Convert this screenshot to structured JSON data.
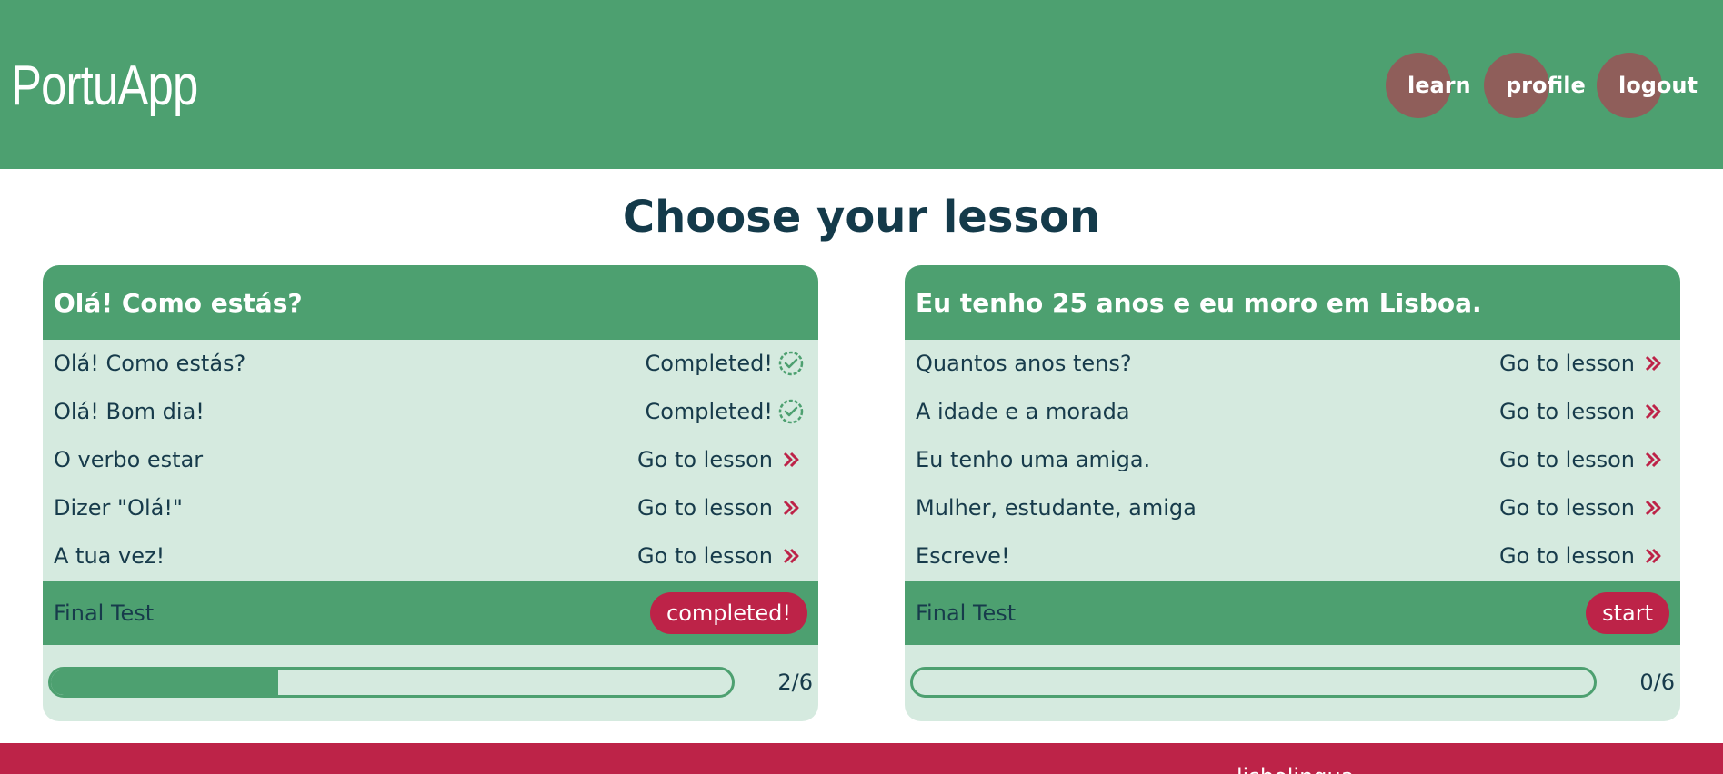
{
  "app": {
    "name": "PortuApp"
  },
  "colors": {
    "brand_green": "#4da070",
    "light_green": "#d5eadf",
    "accent_red": "#bd2348",
    "nav_circle": "#8f5e5a",
    "text_dark": "#173b4b",
    "completed_icon": "#4da070"
  },
  "nav": {
    "items": [
      {
        "label": "learn"
      },
      {
        "label": "profile"
      },
      {
        "label": "logout"
      }
    ]
  },
  "page": {
    "title": "Choose your lesson"
  },
  "units": [
    {
      "title": "Olá! Como estás?",
      "lessons": [
        {
          "name": "Olá! Como estás?",
          "action": "Completed!",
          "status": "completed",
          "icon": "check-badge-icon"
        },
        {
          "name": "Olá! Bom dia!",
          "action": "Completed!",
          "status": "completed",
          "icon": "check-badge-icon"
        },
        {
          "name": "O verbo estar",
          "action": "Go to lesson",
          "status": "open",
          "icon": "double-chevron-right-icon"
        },
        {
          "name": "Dizer \"Olá!\"",
          "action": "Go to lesson",
          "status": "open",
          "icon": "double-chevron-right-icon"
        },
        {
          "name": "A tua vez!",
          "action": "Go to lesson",
          "status": "open",
          "icon": "double-chevron-right-icon"
        }
      ],
      "final_test": {
        "label": "Final Test",
        "button": "completed!"
      },
      "progress": {
        "text": "2/6",
        "fraction": 0.3333
      }
    },
    {
      "title": "Eu tenho 25 anos e eu moro em Lisboa.",
      "lessons": [
        {
          "name": "Quantos anos tens?",
          "action": "Go to lesson",
          "status": "open",
          "icon": "double-chevron-right-icon"
        },
        {
          "name": "A idade e a morada",
          "action": "Go to lesson",
          "status": "open",
          "icon": "double-chevron-right-icon"
        },
        {
          "name": "Eu tenho uma amiga.",
          "action": "Go to lesson",
          "status": "open",
          "icon": "double-chevron-right-icon"
        },
        {
          "name": "Mulher, estudante, amiga",
          "action": "Go to lesson",
          "status": "open",
          "icon": "double-chevron-right-icon"
        },
        {
          "name": "Escreve!",
          "action": "Go to lesson",
          "status": "open",
          "icon": "double-chevron-right-icon"
        }
      ],
      "final_test": {
        "label": "Final Test",
        "button": "start"
      },
      "progress": {
        "text": "0/6",
        "fraction": 0
      }
    }
  ],
  "footer": {
    "text": "lisbolingua"
  }
}
